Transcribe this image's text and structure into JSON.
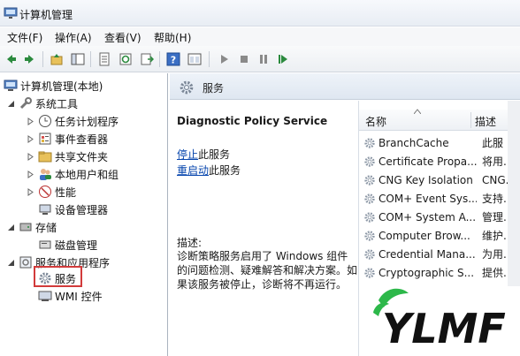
{
  "window": {
    "title": "计算机管理"
  },
  "menu": [
    {
      "label": "文件(F)"
    },
    {
      "label": "操作(A)"
    },
    {
      "label": "查看(V)"
    },
    {
      "label": "帮助(H)"
    }
  ],
  "toolbar": {
    "icons": [
      "back-icon",
      "forward-icon",
      "up-folder-icon",
      "console-tree-icon",
      "properties-icon",
      "refresh-icon",
      "export-icon",
      "help-icon",
      "view-icon",
      "play-icon",
      "stop-icon",
      "pause-icon",
      "restart-icon"
    ]
  },
  "tree": {
    "root": "计算机管理(本地)",
    "system_tools": "系统工具",
    "task_scheduler": "任务计划程序",
    "event_viewer": "事件查看器",
    "shared_folders": "共享文件夹",
    "local_users": "本地用户和组",
    "performance": "性能",
    "device_manager": "设备管理器",
    "storage": "存储",
    "disk_management": "磁盘管理",
    "services_apps": "服务和应用程序",
    "services": "服务",
    "wmi": "WMI 控件"
  },
  "detail": {
    "header": "服务",
    "service_name": "Diagnostic Policy Service",
    "stop_link": "停止",
    "stop_suffix": "此服务",
    "restart_link": "重启动",
    "restart_suffix": "此服务",
    "description_label": "描述:",
    "description_text": "诊断策略服务启用了 Windows 组件的问题检测、疑难解答和解决方案。如果该服务被停止，诊断将不再运行。"
  },
  "service_list": {
    "columns": {
      "name": "名称",
      "description": "描述"
    },
    "rows": [
      {
        "name": "BranchCache",
        "description": "此服"
      },
      {
        "name": "Certificate Propa...",
        "description": "将用..."
      },
      {
        "name": "CNG Key Isolation",
        "description": "CNG..."
      },
      {
        "name": "COM+ Event Sys...",
        "description": "支持..."
      },
      {
        "name": "COM+ System A...",
        "description": "管理..."
      },
      {
        "name": "Computer Brow...",
        "description": "维护..."
      },
      {
        "name": "Credential Mana...",
        "description": "为用..."
      },
      {
        "name": "Cryptographic S...",
        "description": "提供..."
      }
    ]
  },
  "watermark": {
    "text": "YLMF"
  },
  "colors": {
    "selection_box": "#d23b3b",
    "link": "#0645ad",
    "logo_green": "#2db84a"
  }
}
